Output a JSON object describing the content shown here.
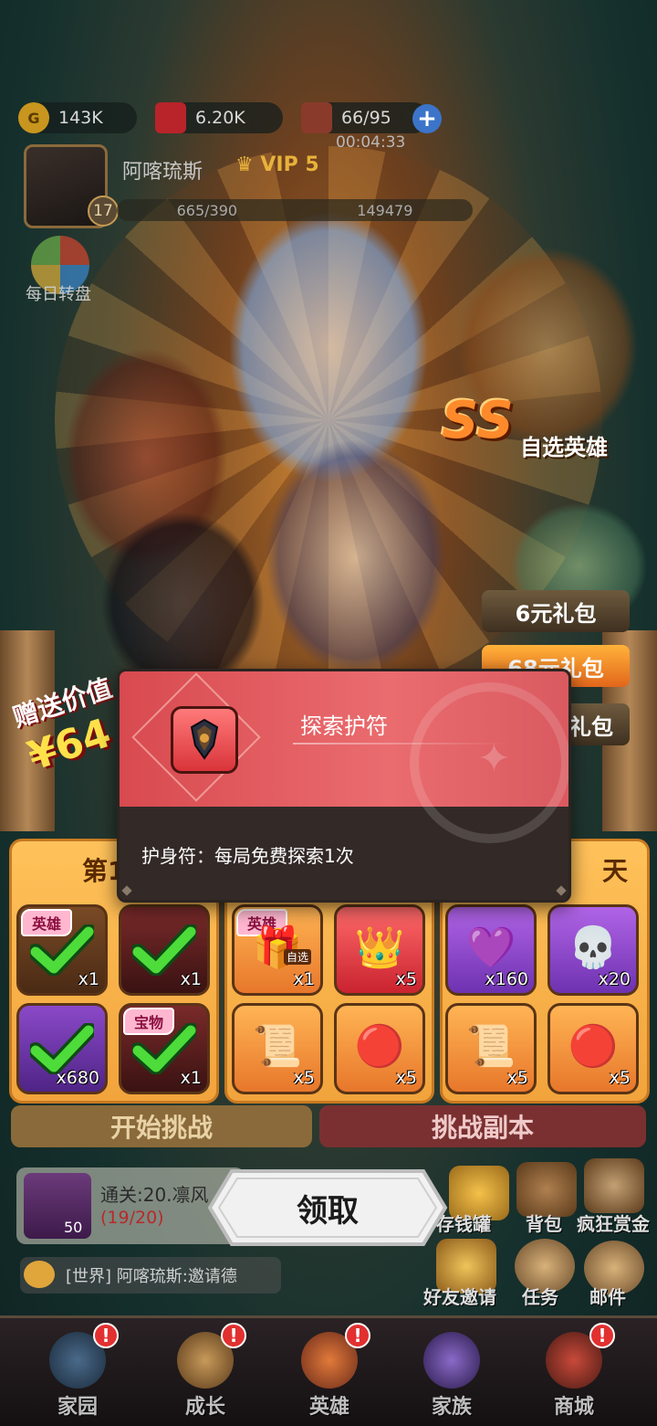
{
  "status": {
    "gold": "143K",
    "gems": "6.20K",
    "stamina": "66/95",
    "stamina_timer": "00:04:33"
  },
  "player": {
    "name": "阿喀琉斯",
    "vip": "VIP 5",
    "level": "17",
    "exp": "665/390",
    "power": "149479"
  },
  "daily_wheel_label": "每日转盘",
  "featured": {
    "grade": "SS",
    "label": "自选英雄"
  },
  "packs": [
    "6元礼包",
    "68元礼包",
    "礼包"
  ],
  "promo": {
    "gift_text": "赠送价值",
    "amount": "¥64"
  },
  "tier_left_title": "第1",
  "tier_right_title": "天",
  "rewards": {
    "left": [
      {
        "qty": "x1",
        "tag": "英雄",
        "claimed": true
      },
      {
        "qty": "x1",
        "tag": "",
        "claimed": true
      },
      {
        "qty": "x680",
        "tag": "",
        "claimed": true
      },
      {
        "qty": "x1",
        "tag": "宝物",
        "claimed": true
      }
    ],
    "middle": [
      {
        "qty": "x1",
        "tag": "英雄",
        "sub": "自选",
        "icon": "hero-chest-icon"
      },
      {
        "qty": "x5",
        "tag": "",
        "icon": "crown-icon"
      },
      {
        "qty": "x5",
        "tag": "",
        "icon": "scroll-icon"
      },
      {
        "qty": "x5",
        "tag": "",
        "icon": "red-gem-icon"
      }
    ],
    "right": [
      {
        "qty": "x160",
        "tag": "",
        "icon": "purple-crystal-icon"
      },
      {
        "qty": "x20",
        "tag": "",
        "icon": "skull-icon"
      },
      {
        "qty": "x5",
        "tag": "",
        "icon": "scroll-icon"
      },
      {
        "qty": "x5",
        "tag": "",
        "icon": "red-gem-icon"
      }
    ]
  },
  "buttons": {
    "start": "开始挑战",
    "dungeon": "挑战副本",
    "claim": "领取"
  },
  "stage": {
    "name": "通关:20.凛风",
    "progress": "(19/20)",
    "badge": "50"
  },
  "chat_text": "[世界] 阿喀琉斯:邀请德",
  "side_buttons": [
    "存钱罐",
    "背包",
    "疯狂赏金",
    "好友邀请",
    "任务",
    "邮件"
  ],
  "nav": [
    "家园",
    "成长",
    "英雄",
    "家族",
    "商城"
  ],
  "tooltip": {
    "title": "探索护符",
    "description": "护身符：每局免费探索1次"
  }
}
